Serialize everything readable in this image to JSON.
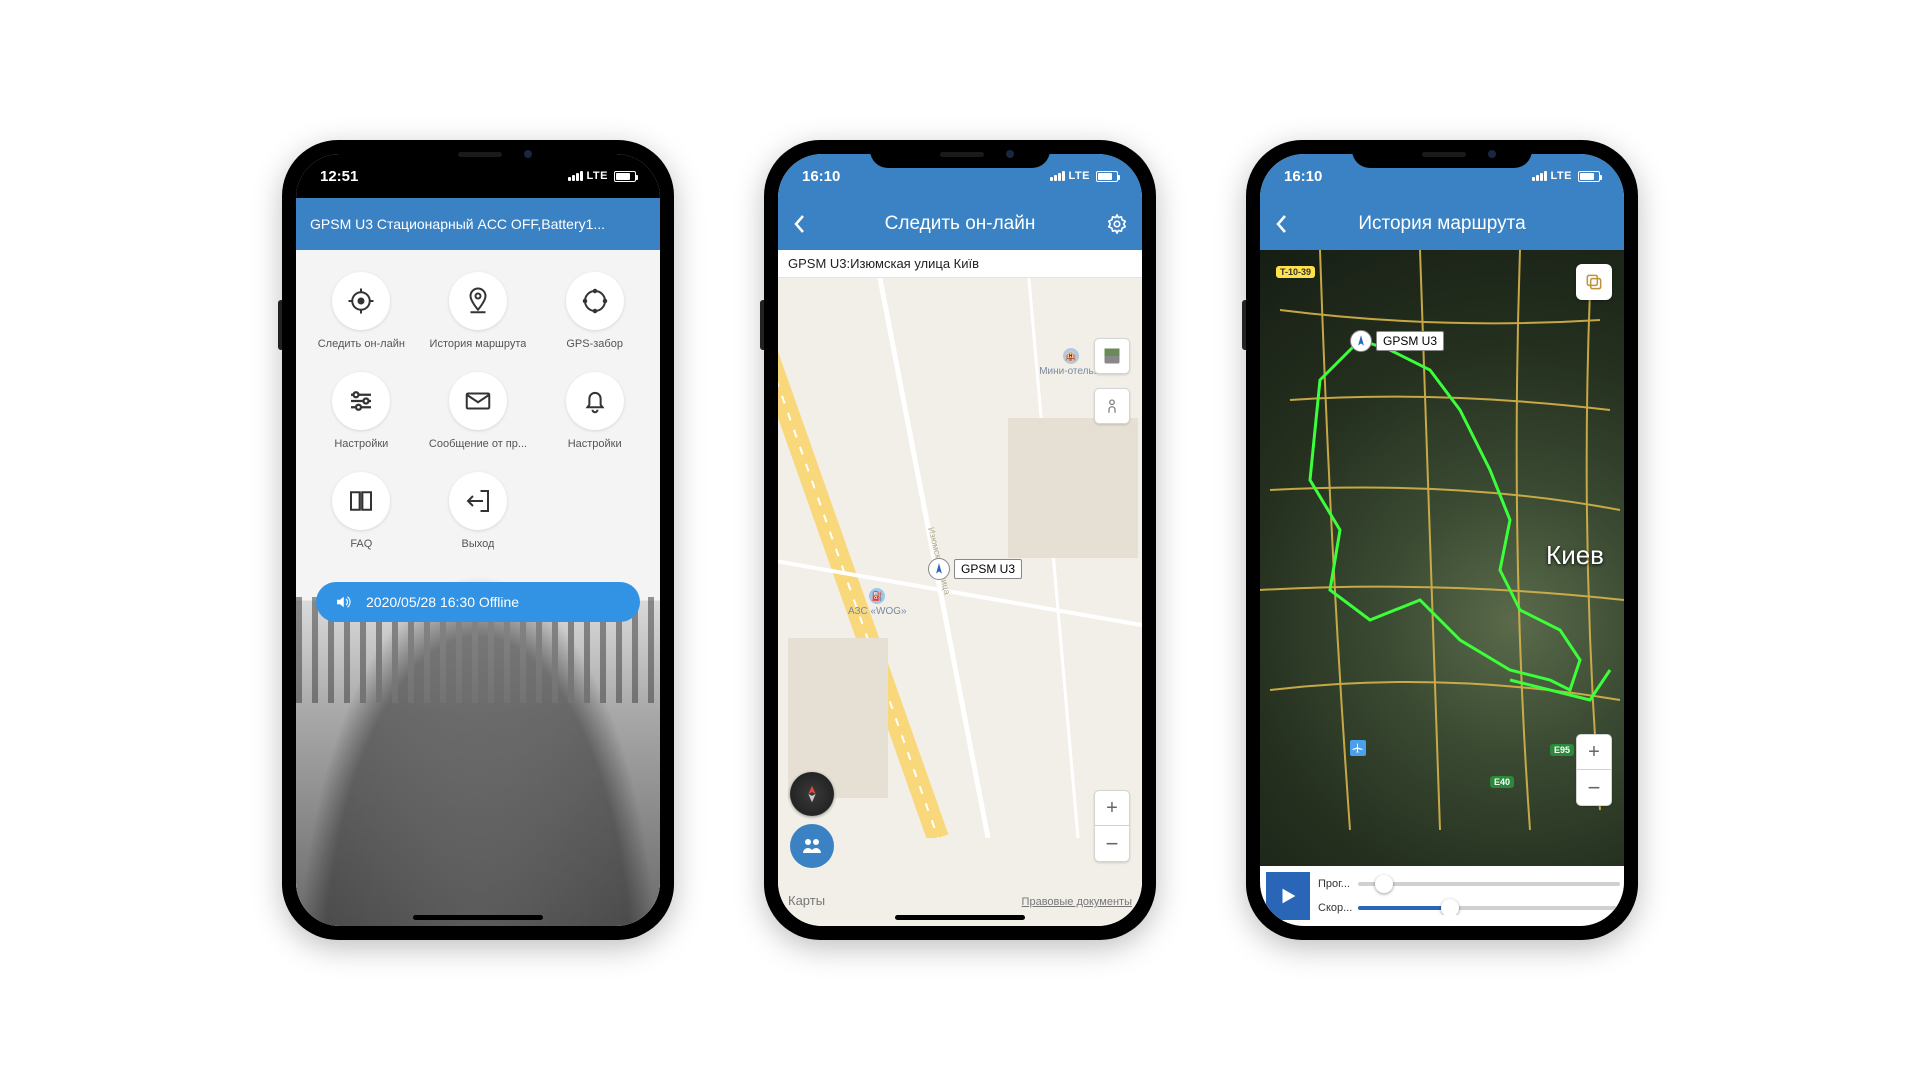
{
  "status": {
    "time1": "12:51",
    "time2": "16:10",
    "time3": "16:10",
    "net": "LTE"
  },
  "phone1": {
    "header": "GPSM U3 Стационарный ACC OFF,Battery1...",
    "items": [
      {
        "label": "Следить он-лайн"
      },
      {
        "label": "История маршрута"
      },
      {
        "label": "GPS-забор"
      },
      {
        "label": "Настройки"
      },
      {
        "label": "Сообщение от пр..."
      },
      {
        "label": "Настройки"
      },
      {
        "label": "FAQ"
      },
      {
        "label": "Выход"
      }
    ],
    "status_line": "2020/05/28 16:30 Offline"
  },
  "phone2": {
    "title": "Следить он-лайн",
    "address": "GPSM U3:Изюмская улица Київ",
    "marker_label": "GPSM U3",
    "poi_hotel": "Мини-отель...",
    "poi_gas": "АЗС «WOG»",
    "street": "Изюмская улица",
    "apple_maps": "Карты",
    "legal": "Правовые документы",
    "zoom_in": "+",
    "zoom_out": "−"
  },
  "phone3": {
    "title": "История маршрута",
    "marker_label": "GPSM U3",
    "city": "Киев",
    "badge_t": "T-10-39",
    "badge_e95": "E95",
    "badge_e40": "E40",
    "zoom_in": "+",
    "zoom_out": "−",
    "slider_progress": "Прог...",
    "slider_speed": "Скор..."
  }
}
